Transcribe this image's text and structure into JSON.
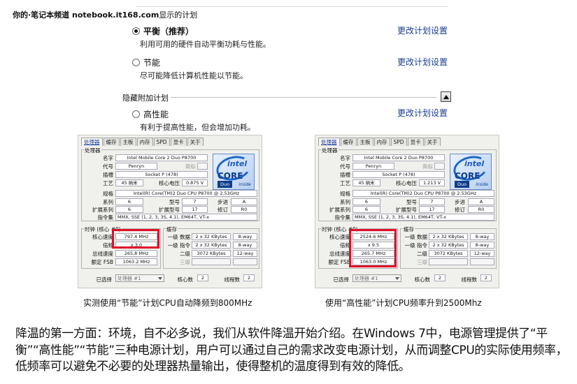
{
  "watermark": "你的·笔记本频道 notebook.it168.com",
  "header_text": "显示的计划",
  "plans": [
    {
      "name": "平衡（推荐）",
      "desc": "利用可用的硬件自动平衡功耗与性能。",
      "link": "更改计划设置",
      "selected": true
    },
    {
      "name": "节能",
      "desc": "尽可能降低计算机性能以节能。",
      "link": "更改计划设置",
      "selected": false
    },
    {
      "name": "高性能",
      "desc": "有利于提高性能，但会增加功耗。",
      "link": "更改计划设置",
      "selected": false
    }
  ],
  "hidden_label": "隐藏附加计划",
  "cpuz": {
    "tabs": [
      "处理器",
      "缓存",
      "主板",
      "内存",
      "SPD",
      "显卡",
      "关于"
    ],
    "group_processor": "处理器",
    "labels": {
      "name": "名字",
      "codename": "代号",
      "brand": "商标",
      "package": "插槽",
      "tech": "工艺",
      "voltage": "核心电压",
      "spec": "规格",
      "family": "系列",
      "model": "型号",
      "stepping": "步进",
      "ext_family": "扩展系列",
      "ext_model": "扩展型号",
      "revision": "修订",
      "instructions": "指令集",
      "clocks": "时钟 (核心 #0)",
      "core_speed": "核心速度",
      "multiplier": "倍频",
      "bus_speed": "总线速度",
      "rated_fsb": "额定 FSB",
      "cache": "缓存",
      "l1_data": "一级 数据",
      "l1_inst": "一级 指令",
      "l2": "二级",
      "l3": "三级",
      "selection": "已选择",
      "cores": "核心数",
      "threads": "线程数"
    },
    "values": {
      "name": "Intel Mobile Core 2 Duo P8700",
      "codename": "Penryn",
      "package": "Socket P (478)",
      "tech": "45 纳米",
      "spec": "Intel(R) Core(TM)2 Duo CPU     P8700  @ 2.53GHz",
      "family": "6",
      "model": "7",
      "stepping": "A",
      "ext_family": "6",
      "ext_model": "17",
      "revision": "R0",
      "instructions": "MMX, SSE (1, 2, 3, 3S, 4.1), EM64T, VT-x",
      "l1_data": "2 x 32 KBytes",
      "l1_data_way": "8-way",
      "l1_inst": "2 x 32 KBytes",
      "l1_inst_way": "8-way",
      "l2": "3072 KBytes",
      "l2_way": "12-way",
      "processor_select": "处理器 #1",
      "cores": "2",
      "threads": "2"
    },
    "logo": {
      "brand": "intel",
      "line": "CORE",
      "sub": "Duo",
      "inside": "inside"
    },
    "left": {
      "voltage": "0.875 V",
      "core_speed": "797.4 MHz",
      "multiplier": "x 3.0",
      "bus_speed": "265.8 MHz",
      "rated_fsb": "1063.2 MHz"
    },
    "right": {
      "voltage": "1.213 V",
      "core_speed": "2524.6 MHz",
      "multiplier": "x 9.5",
      "bus_speed": "265.7 MHz",
      "rated_fsb": "1063.0 MHz"
    }
  },
  "captions": {
    "left": "实测使用“节能”计划CPU自动降频到800MHz",
    "right": "使用“高性能”计划CPU频率升到2500Mhz"
  },
  "paragraph": "降温的第一方面：环境，自不必多说，我们从软件降温开始介绍。在Windows 7中，电源管理提供了“平衡”“高性能”“节能”三种电源计划，用户可以通过自己的需求改变电源计划，从而调整CPU的实际使用频率，低频率可以避免不必要的处理器热量输出，使得整机的温度得到有效的降低。",
  "colors": {
    "link": "#1a3c8c",
    "highlight": "#e0102a",
    "intel_blue": "#1b67c6"
  }
}
